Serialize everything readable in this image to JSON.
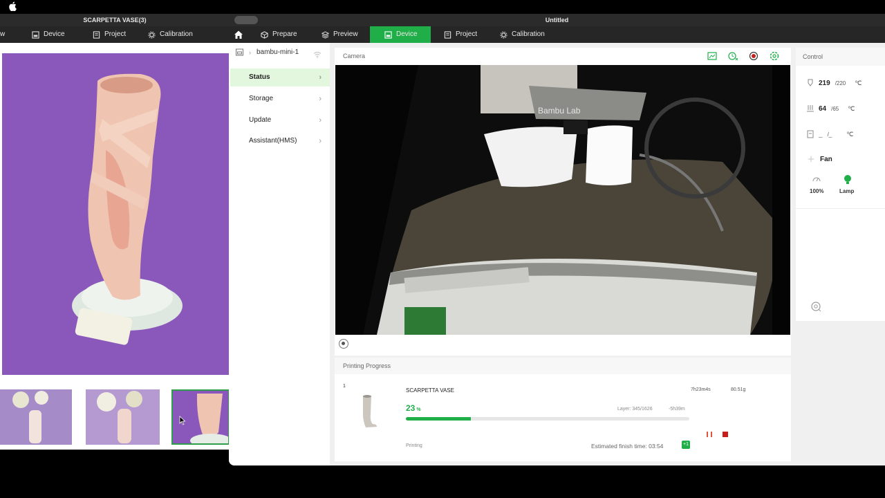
{
  "back_window": {
    "title": "SCARPETTA VASE(3)",
    "nav": {
      "partial": "w",
      "device": "Device",
      "project": "Project",
      "calibration": "Calibration"
    }
  },
  "front_window": {
    "title": "Untitled",
    "nav": {
      "prepare": "Prepare",
      "preview": "Preview",
      "device": "Device",
      "project": "Project",
      "calibration": "Calibration"
    }
  },
  "sidebar": {
    "device_name": "bambu-mini-1",
    "items": [
      {
        "label": "Status",
        "active": true
      },
      {
        "label": "Storage"
      },
      {
        "label": "Update"
      },
      {
        "label": "Assistant(HMS)"
      }
    ]
  },
  "camera": {
    "label": "Camera",
    "icons": [
      "sd-card-icon",
      "timelapse-icon",
      "record-icon",
      "settings-icon"
    ],
    "printer_brand": "Bambu Lab"
  },
  "progress": {
    "label": "Printing Progress",
    "plate_number": "1",
    "task_name": "SCARPETTA VASE",
    "time": "7h23m4s",
    "weight": "80.51g",
    "percent_value": 23,
    "percent_text": "23",
    "percent_unit": "%",
    "layer": "Layer: 345/1626",
    "remaining": "-5h39m",
    "status": "Printing",
    "finish_time": "Estimated finish time: 03:54",
    "plus_badge": "+1"
  },
  "control": {
    "label": "Control",
    "nozzle": {
      "current": "219",
      "target": "/220",
      "unit": "℃"
    },
    "bed": {
      "current": "64",
      "target": "/65",
      "unit": "℃"
    },
    "chamber": {
      "current": "_",
      "target": "/_",
      "unit": "℃"
    },
    "fan_label": "Fan",
    "speed": "100%",
    "lamp": "Lamp"
  },
  "colors": {
    "accent": "#1fae48",
    "nav_bg": "#262626",
    "stop": "#c81e1e"
  }
}
